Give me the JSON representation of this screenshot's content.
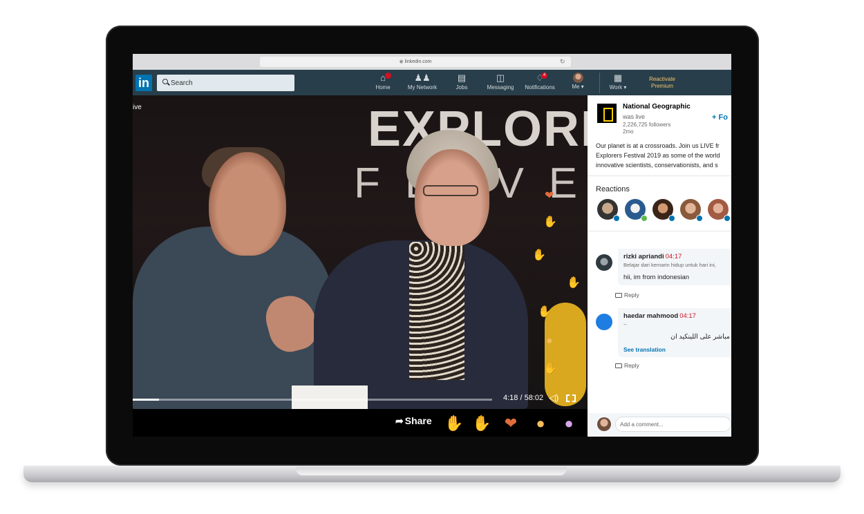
{
  "browser": {
    "url": "linkedin.com"
  },
  "nav": {
    "logo": "in",
    "search_placeholder": "Search",
    "items": [
      {
        "label": "Home",
        "icon": "home-icon"
      },
      {
        "label": "My Network",
        "icon": "people-icon"
      },
      {
        "label": "Jobs",
        "icon": "briefcase-icon"
      },
      {
        "label": "Messaging",
        "icon": "chat-icon"
      },
      {
        "label": "Notifications",
        "icon": "bell-icon",
        "badge": "4"
      },
      {
        "label": "Me",
        "icon": "avatar"
      },
      {
        "label": "Work",
        "icon": "grid-icon"
      }
    ],
    "premium": "Reactivate Premium"
  },
  "video": {
    "live_label": "ive",
    "banner_line_1": "EXPLORE",
    "banner_line_2": "FEIVE",
    "time": "4:18 / 58:02",
    "progress": 0.074,
    "share_label": "Share"
  },
  "post": {
    "org_name": "National Geographic",
    "status": "was live",
    "followers": "2,226,725 followers",
    "age": "2mo",
    "follow_label": "+ Fo",
    "text_lines": [
      "Our planet is at a crossroads. Join us LIVE fr",
      "Explorers Festival 2019 as some of the world",
      "innovative scientists, conservationists, and s"
    ]
  },
  "reactions": {
    "title": "Reactions"
  },
  "comments": [
    {
      "author": "rizki apriandi",
      "time": "04:17",
      "subtitle": "Belajar dari kemarin hidup untuk hari ini,",
      "body": "hii, im from indonesian",
      "reply": "Reply"
    },
    {
      "author": "haedar mahmood",
      "time": "04:17",
      "subtitle": "--",
      "body": "مباشر على اللينكيد ان",
      "translation": "See translation",
      "reply": "Reply"
    }
  ],
  "comment_box": {
    "placeholder": "Add a comment..."
  },
  "colors": {
    "nav_bg": "#283e4a",
    "brand": "#0073b1",
    "premium": "#f5c46b",
    "timestamp": "#d11124"
  }
}
